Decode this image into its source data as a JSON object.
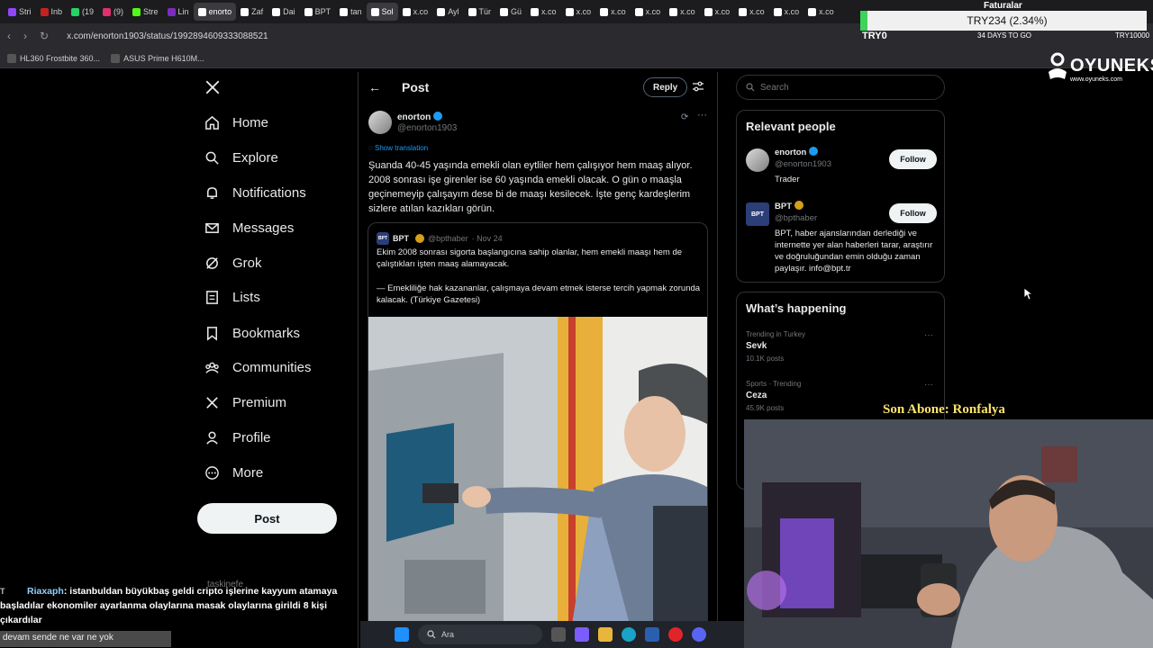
{
  "browser": {
    "tabs": [
      {
        "label": "Stri",
        "color": "#9146ff"
      },
      {
        "label": "Inb",
        "color": "#c5221f"
      },
      {
        "label": "(19",
        "color": "#25d366"
      },
      {
        "label": "(9)",
        "color": "#e1306c"
      },
      {
        "label": "Stre",
        "color": "#53fc18"
      },
      {
        "label": "Lin",
        "color": "#7b2cbf"
      },
      {
        "label": "enorto",
        "color": "#ffffff",
        "active": true
      },
      {
        "label": "Zaf",
        "color": "#ffffff"
      },
      {
        "label": "Dai",
        "color": "#ffffff"
      },
      {
        "label": "BPT",
        "color": "#ffffff"
      },
      {
        "label": "tan",
        "color": "#ffffff"
      },
      {
        "label": "Sol",
        "color": "#ffffff",
        "active": true
      },
      {
        "label": "x.co",
        "color": "#ffffff"
      },
      {
        "label": "Ayl",
        "color": "#ffffff"
      },
      {
        "label": "Tür",
        "color": "#ffffff"
      },
      {
        "label": "Gü",
        "color": "#ffffff"
      },
      {
        "label": "x.co",
        "color": "#ffffff"
      },
      {
        "label": "x.co",
        "color": "#ffffff"
      },
      {
        "label": "x.co",
        "color": "#ffffff"
      },
      {
        "label": "x.co",
        "color": "#ffffff"
      },
      {
        "label": "x.co",
        "color": "#ffffff"
      },
      {
        "label": "x.co",
        "color": "#ffffff"
      },
      {
        "label": "x.co",
        "color": "#ffffff"
      },
      {
        "label": "x.co",
        "color": "#ffffff"
      },
      {
        "label": "x.co",
        "color": "#ffffff"
      }
    ],
    "url": "x.com/enorton1903/status/1992894609333088521",
    "bookmarks": [
      "HL360 Frostbite 360...",
      "ASUS Prime H610M..."
    ]
  },
  "overlay": {
    "faturalar": "Faturalar",
    "ticker_main": "TRY234 (2.34%)",
    "ticker_small": "TRY0",
    "ticker_days": "34 DAYS TO GO",
    "ticker_right": "TRY10000",
    "logo_brand": "OYUNEKS",
    "logo_site": "www.oyuneks.com",
    "son_abone": "Son Abone: Ronfalya"
  },
  "nav": {
    "items": [
      {
        "label": "Home",
        "icon": "home-icon"
      },
      {
        "label": "Explore",
        "icon": "search-icon"
      },
      {
        "label": "Notifications",
        "icon": "bell-icon"
      },
      {
        "label": "Messages",
        "icon": "envelope-icon"
      },
      {
        "label": "Grok",
        "icon": "grok-icon"
      },
      {
        "label": "Lists",
        "icon": "list-icon"
      },
      {
        "label": "Bookmarks",
        "icon": "bookmark-icon"
      },
      {
        "label": "Communities",
        "icon": "communities-icon"
      },
      {
        "label": "Premium",
        "icon": "x-icon"
      },
      {
        "label": "Profile",
        "icon": "person-icon"
      },
      {
        "label": "More",
        "icon": "more-icon"
      }
    ],
    "post_button": "Post",
    "account_ghost": "taskinefe"
  },
  "post": {
    "header_title": "Post",
    "reply_label": "Reply",
    "author_name": "enorton",
    "author_handle": "@enorton1903",
    "show_translation": "Show translation",
    "text": "Şuanda 40-45 yaşında emekli olan eytliler hem çalışıyor hem maaş alıyor. 2008 sonrası işe girenler ise 60 yaşında emekli olacak. O gün o maaşla geçinemeyip çalışayım dese bi de maaşı kesilecek. İşte genç kardeşlerim sizlere atılan kazıkları görün.",
    "quote": {
      "logo_text": "BPT",
      "name": "BPT",
      "handle": "@bpthaber",
      "date": "· Nov 24",
      "text1": "Ekim 2008 sonrası sigorta başlangıcına sahip olanlar, hem emekli maaşı hem de çalıştıkları işten maaş alamayacak.",
      "text2": "— Emekliliğe hak kazananlar, çalışmaya devam etmek isterse tercih yapmak zorunda kalacak. (Türkiye Gazetesi)"
    }
  },
  "sidebar": {
    "search_placeholder": "Search",
    "relevant_title": "Relevant people",
    "people": [
      {
        "name": "enorton",
        "handle": "@enorton1903",
        "bio": "Trader",
        "follow": "Follow",
        "badge": "#1d9bf0"
      },
      {
        "name": "BPT",
        "handle": "@bpthaber",
        "bio": "BPT, haber ajanslarından derlediği ve internette yer alan haberleri tarar, araştırır ve doğruluğundan emin olduğu zaman paylaşır. info@bpt.tr",
        "follow": "Follow",
        "badge": "#d4a017"
      }
    ],
    "happening_title": "What’s happening",
    "trends": [
      {
        "meta": "Trending in Turkey",
        "name": "Sevk",
        "count": "10.1K posts"
      },
      {
        "meta": "Sports · Trending",
        "name": "Ceza",
        "count": "45.9K posts"
      }
    ]
  },
  "chat": {
    "badges": "T",
    "name": "Riaxaph",
    "message": ": istanbuldan büyükbaş geldi cripto işlerine kayyum atamaya başladılar ekonomiler ayarlanma olaylarına masak olaylarına girildi 8 kişi çıkardılar",
    "line2": "devam sende ne var ne yok"
  },
  "taskbar": {
    "search_label": "Ara"
  }
}
